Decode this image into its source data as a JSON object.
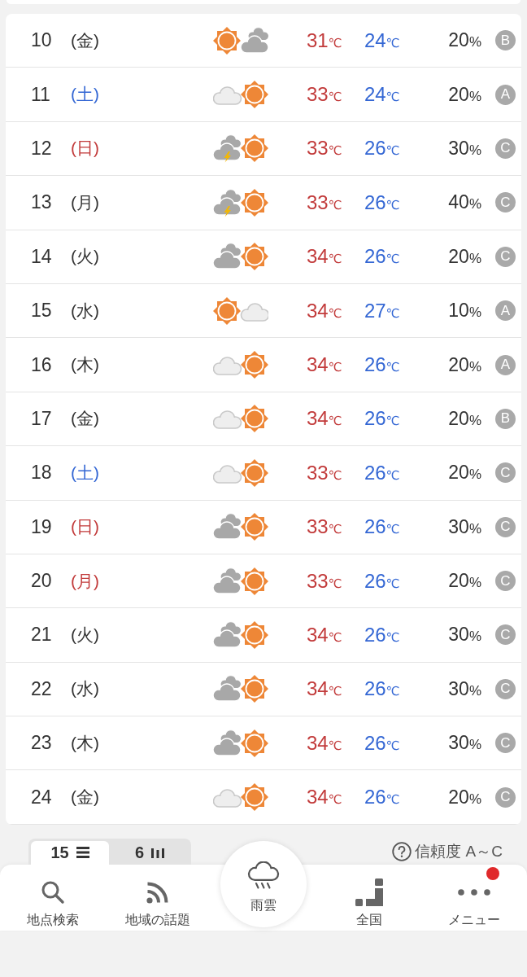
{
  "forecast": {
    "rows": [
      {
        "day": "10",
        "weekday": {
          "label": "(金)",
          "kind": "weekday"
        },
        "weather": [
          {
            "kind": "sun"
          },
          {
            "kind": "cloud"
          }
        ],
        "high": {
          "value": "31",
          "unit": "℃"
        },
        "low": {
          "value": "24",
          "unit": "℃"
        },
        "precipitation": {
          "value": "20",
          "unit": "%"
        },
        "reliability": "B"
      },
      {
        "day": "11",
        "weekday": {
          "label": "(土)",
          "kind": "saturday"
        },
        "weather": [
          {
            "kind": "lightcloud"
          },
          {
            "kind": "sun"
          }
        ],
        "high": {
          "value": "33",
          "unit": "℃"
        },
        "low": {
          "value": "24",
          "unit": "℃"
        },
        "precipitation": {
          "value": "20",
          "unit": "%"
        },
        "reliability": "A"
      },
      {
        "day": "12",
        "weekday": {
          "label": "(日)",
          "kind": "holiday"
        },
        "weather": [
          {
            "kind": "thundercloud"
          },
          {
            "kind": "sun"
          }
        ],
        "high": {
          "value": "33",
          "unit": "℃"
        },
        "low": {
          "value": "26",
          "unit": "℃"
        },
        "precipitation": {
          "value": "30",
          "unit": "%"
        },
        "reliability": "C"
      },
      {
        "day": "13",
        "weekday": {
          "label": "(月)",
          "kind": "weekday"
        },
        "weather": [
          {
            "kind": "thundercloud"
          },
          {
            "kind": "sun"
          }
        ],
        "high": {
          "value": "33",
          "unit": "℃"
        },
        "low": {
          "value": "26",
          "unit": "℃"
        },
        "precipitation": {
          "value": "40",
          "unit": "%"
        },
        "reliability": "C"
      },
      {
        "day": "14",
        "weekday": {
          "label": "(火)",
          "kind": "weekday"
        },
        "weather": [
          {
            "kind": "cloud"
          },
          {
            "kind": "sun"
          }
        ],
        "high": {
          "value": "34",
          "unit": "℃"
        },
        "low": {
          "value": "26",
          "unit": "℃"
        },
        "precipitation": {
          "value": "20",
          "unit": "%"
        },
        "reliability": "C"
      },
      {
        "day": "15",
        "weekday": {
          "label": "(水)",
          "kind": "weekday"
        },
        "weather": [
          {
            "kind": "sun"
          },
          {
            "kind": "lightcloud"
          }
        ],
        "high": {
          "value": "34",
          "unit": "℃"
        },
        "low": {
          "value": "27",
          "unit": "℃"
        },
        "precipitation": {
          "value": "10",
          "unit": "%"
        },
        "reliability": "A"
      },
      {
        "day": "16",
        "weekday": {
          "label": "(木)",
          "kind": "weekday"
        },
        "weather": [
          {
            "kind": "lightcloud"
          },
          {
            "kind": "sun"
          }
        ],
        "high": {
          "value": "34",
          "unit": "℃"
        },
        "low": {
          "value": "26",
          "unit": "℃"
        },
        "precipitation": {
          "value": "20",
          "unit": "%"
        },
        "reliability": "A"
      },
      {
        "day": "17",
        "weekday": {
          "label": "(金)",
          "kind": "weekday"
        },
        "weather": [
          {
            "kind": "lightcloud"
          },
          {
            "kind": "sun"
          }
        ],
        "high": {
          "value": "34",
          "unit": "℃"
        },
        "low": {
          "value": "26",
          "unit": "℃"
        },
        "precipitation": {
          "value": "20",
          "unit": "%"
        },
        "reliability": "B"
      },
      {
        "day": "18",
        "weekday": {
          "label": "(土)",
          "kind": "saturday"
        },
        "weather": [
          {
            "kind": "lightcloud"
          },
          {
            "kind": "sun"
          }
        ],
        "high": {
          "value": "33",
          "unit": "℃"
        },
        "low": {
          "value": "26",
          "unit": "℃"
        },
        "precipitation": {
          "value": "20",
          "unit": "%"
        },
        "reliability": "C"
      },
      {
        "day": "19",
        "weekday": {
          "label": "(日)",
          "kind": "holiday"
        },
        "weather": [
          {
            "kind": "cloud"
          },
          {
            "kind": "sun"
          }
        ],
        "high": {
          "value": "33",
          "unit": "℃"
        },
        "low": {
          "value": "26",
          "unit": "℃"
        },
        "precipitation": {
          "value": "30",
          "unit": "%"
        },
        "reliability": "C"
      },
      {
        "day": "20",
        "weekday": {
          "label": "(月)",
          "kind": "holiday"
        },
        "weather": [
          {
            "kind": "cloud"
          },
          {
            "kind": "sun"
          }
        ],
        "high": {
          "value": "33",
          "unit": "℃"
        },
        "low": {
          "value": "26",
          "unit": "℃"
        },
        "precipitation": {
          "value": "20",
          "unit": "%"
        },
        "reliability": "C"
      },
      {
        "day": "21",
        "weekday": {
          "label": "(火)",
          "kind": "weekday"
        },
        "weather": [
          {
            "kind": "cloud"
          },
          {
            "kind": "sun"
          }
        ],
        "high": {
          "value": "34",
          "unit": "℃"
        },
        "low": {
          "value": "26",
          "unit": "℃"
        },
        "precipitation": {
          "value": "30",
          "unit": "%"
        },
        "reliability": "C"
      },
      {
        "day": "22",
        "weekday": {
          "label": "(水)",
          "kind": "weekday"
        },
        "weather": [
          {
            "kind": "cloud"
          },
          {
            "kind": "sun"
          }
        ],
        "high": {
          "value": "34",
          "unit": "℃"
        },
        "low": {
          "value": "26",
          "unit": "℃"
        },
        "precipitation": {
          "value": "30",
          "unit": "%"
        },
        "reliability": "C"
      },
      {
        "day": "23",
        "weekday": {
          "label": "(木)",
          "kind": "weekday"
        },
        "weather": [
          {
            "kind": "cloud"
          },
          {
            "kind": "sun"
          }
        ],
        "high": {
          "value": "34",
          "unit": "℃"
        },
        "low": {
          "value": "26",
          "unit": "℃"
        },
        "precipitation": {
          "value": "30",
          "unit": "%"
        },
        "reliability": "C"
      },
      {
        "day": "24",
        "weekday": {
          "label": "(金)",
          "kind": "weekday"
        },
        "weather": [
          {
            "kind": "lightcloud"
          },
          {
            "kind": "sun"
          }
        ],
        "high": {
          "value": "34",
          "unit": "℃"
        },
        "low": {
          "value": "26",
          "unit": "℃"
        },
        "precipitation": {
          "value": "20",
          "unit": "%"
        },
        "reliability": "C"
      }
    ]
  },
  "view_toggle": [
    {
      "kind": "list",
      "label": "15",
      "selected": true
    },
    {
      "kind": "chart",
      "label": "6",
      "selected": false
    }
  ],
  "reliability_help": {
    "label": "信頼度 A～C"
  },
  "tab_bar": [
    {
      "kind": "search",
      "label": "地点検索",
      "notification": false
    },
    {
      "kind": "feed",
      "label": "地域の話題",
      "notification": false
    },
    {
      "kind": "rain",
      "label": "雨雲",
      "notification": false
    },
    {
      "kind": "map",
      "label": "全国",
      "notification": false
    },
    {
      "kind": "more",
      "label": "メニュー",
      "notification": true
    }
  ]
}
